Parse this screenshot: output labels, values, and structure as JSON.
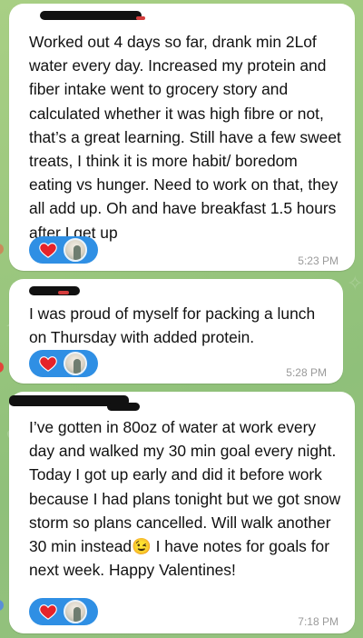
{
  "messages": [
    {
      "text": "Worked out 4 days so far, drank min 2Lof water every day. Increased my protein and fiber intake went to grocery story and calculated whether it was high fibre or not, that’s a great learning. Still have a few sweet treats, I think it is more habit/ boredom eating vs hunger. Need to work on that, they all add up. Oh and have breakfast 1.5 hours after I get up",
      "time": "5:23 PM",
      "reaction": "heart"
    },
    {
      "text": "I was proud of myself for packing a lunch on Thursday with added protein.",
      "time": "5:28 PM",
      "reaction": "heart"
    },
    {
      "text": "I’ve gotten in 80oz of water at work every day and walked my 30 min goal every night. Today I got up early and did it before work because I had plans tonight but we got snow storm so plans cancelled. Will walk another 30 min instead😉 I have notes for goals for next week. Happy Valentines!",
      "time": "7:18 PM",
      "reaction": "heart"
    }
  ],
  "colors": {
    "background": "#9bc77e",
    "bubble": "#ffffff",
    "reaction_pill": "#2f8fe4",
    "heart": "#e5232a",
    "timestamp": "#9a9a9a"
  },
  "icons": {
    "reaction": "heart-icon",
    "reactor": "avatar"
  }
}
